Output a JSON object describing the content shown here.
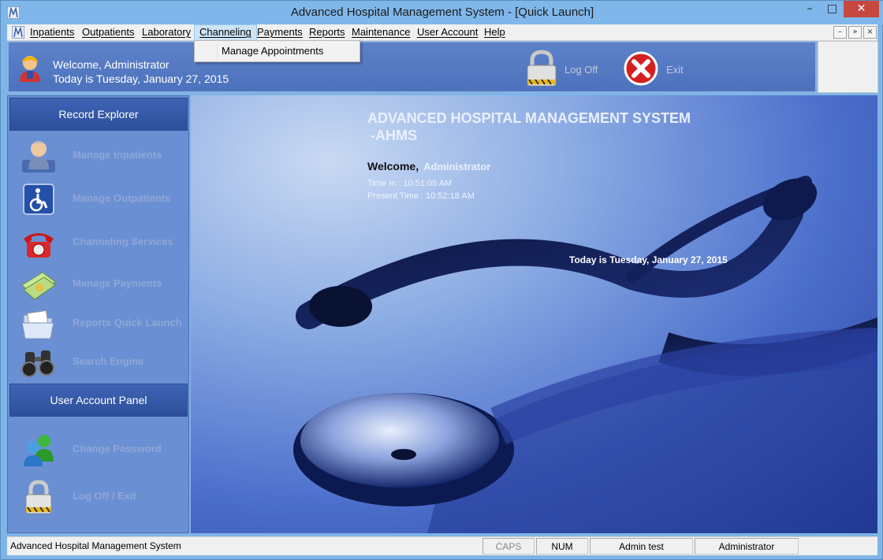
{
  "window": {
    "title": "Advanced Hospital Management System - [Quick Launch]",
    "minimize": "–",
    "maximize": "□",
    "close": "✕"
  },
  "menu": {
    "items": [
      "Inpatients",
      "Outpatients",
      "Laboratory",
      "Channeling",
      "Payments",
      "Reports",
      "Maintenance",
      "User Account",
      "Help"
    ],
    "open_item": "Channeling",
    "dropdown": [
      "Manage Appointments"
    ],
    "mdi_controls": [
      "–",
      "»",
      "×"
    ]
  },
  "header": {
    "welcome": "Welcome, Administrator",
    "today": "Today is Tuesday, January 27, 2015",
    "logoff_label": "Log Off",
    "exit_label": "Exit"
  },
  "sidebar": {
    "record_explorer_title": "Record Explorer",
    "record_items": [
      {
        "label": "Manage Inpatients",
        "icon": "patient-icon"
      },
      {
        "label": "Manage Outpatients",
        "icon": "wheelchair-icon"
      },
      {
        "label": "Channeling Services",
        "icon": "telephone-icon"
      },
      {
        "label": "Manage Payments",
        "icon": "money-icon"
      },
      {
        "label": "Reports Quick Launch",
        "icon": "folder-icon"
      },
      {
        "label": "Search Engine",
        "icon": "binoculars-icon"
      }
    ],
    "user_panel_title": "User Account Panel",
    "user_items": [
      {
        "label": "Change Password",
        "icon": "users-icon"
      },
      {
        "label": "Log Off / Exit",
        "icon": "lock-icon"
      }
    ]
  },
  "main": {
    "title_line1": "ADVANCED HOSPITAL MANAGEMENT SYSTEM",
    "title_line2": "-AHMS",
    "welcome_label": "Welcome,",
    "welcome_name": "Administrator",
    "time_in": "Time In :   10:51:05 AM",
    "present_time": "Present Time :  10:52:18 AM",
    "today": "Today is Tuesday, January 27, 2015"
  },
  "statusbar": {
    "app_name": "Advanced Hospital Management System",
    "caps": "CAPS",
    "num": "NUM",
    "user": "Admin test",
    "role": "Administrator"
  },
  "colors": {
    "header_bg": "#5d82c9",
    "sidebar_bg": "#6a8fd3",
    "section_head": "#2d4f9b",
    "close_red": "#c7483f"
  }
}
